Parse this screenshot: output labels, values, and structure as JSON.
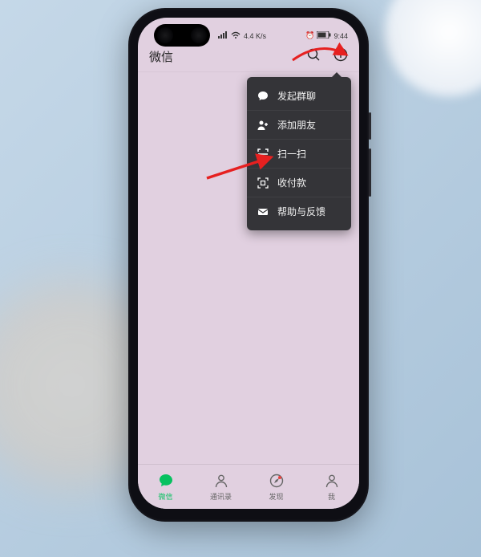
{
  "status": {
    "net": "4.4 K/s",
    "battery_pct": "9:44"
  },
  "header": {
    "title": "微信"
  },
  "dropdown": {
    "items": [
      {
        "label": "发起群聊"
      },
      {
        "label": "添加朋友"
      },
      {
        "label": "扫一扫"
      },
      {
        "label": "收付款"
      },
      {
        "label": "帮助与反馈"
      }
    ]
  },
  "tabs": [
    {
      "label": "微信"
    },
    {
      "label": "通讯录"
    },
    {
      "label": "发现"
    },
    {
      "label": "我"
    }
  ]
}
